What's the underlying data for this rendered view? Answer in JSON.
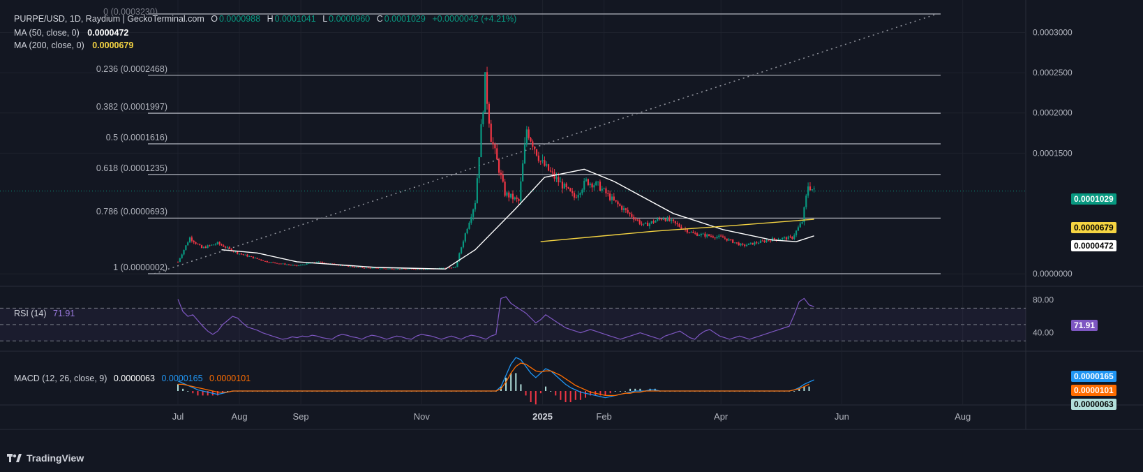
{
  "header": {
    "symbol": "PURPE/USD, 1D, Raydium | GeckoTerminal.com",
    "o_label": "O",
    "o_value": "0.0000988",
    "h_label": "H",
    "h_value": "0.0001041",
    "l_label": "L",
    "l_value": "0.0000960",
    "c_label": "C",
    "c_value": "0.0001029",
    "change": "+0.0000042 (+4.21%)"
  },
  "ma50": {
    "label": "MA (50, close, 0)",
    "value": "0.0000472",
    "color": "#ffffff"
  },
  "ma200": {
    "label": "MA (200, close, 0)",
    "value": "0.0000679",
    "color": "#f5d442"
  },
  "fib_levels": [
    {
      "label": "0 (0.0003230)",
      "price": 0.000323
    },
    {
      "label": "0.236 (0.0002468)",
      "price": 0.0002468
    },
    {
      "label": "0.382 (0.0001997)",
      "price": 0.0001997
    },
    {
      "label": "0.5 (0.0001616)",
      "price": 0.0001616
    },
    {
      "label": "0.618 (0.0001235)",
      "price": 0.0001235
    },
    {
      "label": "0.786 (0.0000693)",
      "price": 6.93e-05
    },
    {
      "label": "1 (0.0000002)",
      "price": 2e-07
    }
  ],
  "price_axis": {
    "ticks": [
      {
        "label": "0.0003000",
        "value": 0.0003
      },
      {
        "label": "0.0002500",
        "value": 0.00025
      },
      {
        "label": "0.0002000",
        "value": 0.0002
      },
      {
        "label": "0.0001500",
        "value": 0.00015
      },
      {
        "label": "0.0000000",
        "value": 0.0
      }
    ],
    "current_price": {
      "label": "0.0001029",
      "value": 0.0001029,
      "color": "#089981"
    },
    "ma200_tag": {
      "label": "0.0000679",
      "value": 6.79e-05,
      "color": "#f5d442"
    },
    "ma50_tag": {
      "label": "0.0000472",
      "value": 4.72e-05,
      "color": "#ffffff"
    }
  },
  "rsi": {
    "label": "RSI (14)",
    "value": "71.91",
    "color": "#7e57c2",
    "ticks": [
      {
        "label": "80.00",
        "value": 80
      },
      {
        "label": "40.00",
        "value": 40
      }
    ],
    "upper": 70,
    "lower": 30,
    "series": [
      81,
      66,
      60,
      62,
      55,
      48,
      42,
      38,
      42,
      50,
      55,
      60,
      58,
      52,
      47,
      45,
      43,
      40,
      38,
      36,
      34,
      32,
      33,
      35,
      34,
      36,
      35,
      37,
      36,
      34,
      33,
      32,
      36,
      38,
      37,
      35,
      34,
      32,
      35,
      37,
      36,
      34,
      32,
      34,
      36,
      35,
      33,
      32,
      36,
      38,
      37,
      36,
      34,
      32,
      34,
      36,
      34,
      32,
      35,
      37,
      36,
      34,
      32,
      36,
      38,
      82,
      84,
      76,
      72,
      68,
      64,
      58,
      52,
      56,
      62,
      58,
      54,
      50,
      46,
      44,
      42,
      40,
      42,
      44,
      42,
      40,
      38,
      36,
      34,
      32,
      34,
      36,
      38,
      40,
      38,
      36,
      34,
      32,
      36,
      38,
      40,
      42,
      38,
      34,
      32,
      38,
      42,
      44,
      40,
      36,
      34,
      32,
      34,
      36,
      34,
      32,
      34,
      36,
      38,
      40,
      42,
      44,
      46,
      48,
      62,
      78,
      82,
      74,
      71.91
    ]
  },
  "macd": {
    "label": "MACD (12, 26, close, 9)",
    "hist_value": "0.0000063",
    "macd_value": "0.0000165",
    "signal_value": "0.0000101",
    "macd_color": "#2196f3",
    "signal_color": "#ff6d00",
    "hist_color": "#b2dfdb",
    "macd_series": [
      9,
      7,
      5,
      3,
      1,
      0,
      -1,
      -2,
      -3,
      -2,
      -1,
      0,
      0,
      0,
      0,
      0,
      0,
      0,
      0,
      0,
      0,
      0,
      0,
      0,
      0,
      0,
      0,
      0,
      0,
      0,
      0,
      0,
      0,
      0,
      0,
      0,
      0,
      0,
      0,
      0,
      0,
      0,
      0,
      0,
      0,
      0,
      0,
      0,
      0,
      0,
      0,
      0,
      0,
      0,
      0,
      0,
      0,
      0,
      0,
      0,
      0,
      0,
      0,
      0,
      0,
      4,
      14,
      24,
      30,
      28,
      22,
      16,
      12,
      16,
      20,
      18,
      14,
      10,
      6,
      3,
      1,
      -1,
      -2,
      -3,
      -4,
      -5,
      -6,
      -5,
      -4,
      -3,
      -2,
      -1,
      0,
      0,
      0,
      1,
      1,
      0,
      0,
      0,
      0,
      0,
      0,
      0,
      0,
      0,
      0,
      0,
      0,
      0,
      0,
      0,
      0,
      0,
      0,
      0,
      0,
      0,
      0,
      0,
      0,
      0,
      0,
      0,
      1,
      3,
      6,
      8,
      10
    ],
    "signal_series": [
      6,
      6,
      5,
      4,
      3,
      2,
      1,
      0,
      -1,
      -1,
      -1,
      0,
      0,
      0,
      0,
      0,
      0,
      0,
      0,
      0,
      0,
      0,
      0,
      0,
      0,
      0,
      0,
      0,
      0,
      0,
      0,
      0,
      0,
      0,
      0,
      0,
      0,
      0,
      0,
      0,
      0,
      0,
      0,
      0,
      0,
      0,
      0,
      0,
      0,
      0,
      0,
      0,
      0,
      0,
      0,
      0,
      0,
      0,
      0,
      0,
      0,
      0,
      0,
      0,
      0,
      2,
      8,
      16,
      22,
      25,
      24,
      21,
      18,
      17,
      18,
      18,
      16,
      14,
      11,
      8,
      5,
      3,
      1,
      -1,
      -2,
      -3,
      -4,
      -4,
      -4,
      -3,
      -2,
      -2,
      -1,
      -1,
      0,
      0,
      0,
      0,
      0,
      0,
      0,
      0,
      0,
      0,
      0,
      0,
      0,
      0,
      0,
      0,
      0,
      0,
      0,
      0,
      0,
      0,
      0,
      0,
      0,
      0,
      0,
      0,
      0,
      0,
      1,
      2,
      4,
      6
    ]
  },
  "time_axis": {
    "ticks": [
      {
        "label": "Jul",
        "day": 0,
        "bold": false
      },
      {
        "label": "Aug",
        "day": 31,
        "bold": false
      },
      {
        "label": "Sep",
        "day": 62,
        "bold": false
      },
      {
        "label": "Nov",
        "day": 123,
        "bold": false
      },
      {
        "label": "2025",
        "day": 184,
        "bold": true
      },
      {
        "label": "Feb",
        "day": 215,
        "bold": false
      },
      {
        "label": "Apr",
        "day": 274,
        "bold": false
      },
      {
        "label": "Jun",
        "day": 335,
        "bold": false
      },
      {
        "label": "Aug",
        "day": 396,
        "bold": false
      }
    ]
  },
  "chart_data": {
    "type": "candlestick",
    "price_points": [
      {
        "day": -12,
        "price": 2e-07
      },
      {
        "day": 0,
        "price": 1.5e-05
      },
      {
        "day": 6,
        "price": 4.5e-05
      },
      {
        "day": 12,
        "price": 3.2e-05
      },
      {
        "day": 20,
        "price": 3.8e-05
      },
      {
        "day": 30,
        "price": 2.6e-05
      },
      {
        "day": 45,
        "price": 1.5e-05
      },
      {
        "day": 60,
        "price": 1e-05
      },
      {
        "day": 70,
        "price": 1.5e-05
      },
      {
        "day": 90,
        "price": 8e-06
      },
      {
        "day": 110,
        "price": 6e-06
      },
      {
        "day": 125,
        "price": 6e-06
      },
      {
        "day": 140,
        "price": 8e-06
      },
      {
        "day": 145,
        "price": 5e-05
      },
      {
        "day": 150,
        "price": 9e-05
      },
      {
        "day": 155,
        "price": 0.00024
      },
      {
        "day": 158,
        "price": 0.00017
      },
      {
        "day": 165,
        "price": 0.0001
      },
      {
        "day": 172,
        "price": 9e-05
      },
      {
        "day": 176,
        "price": 0.00018
      },
      {
        "day": 183,
        "price": 0.00014
      },
      {
        "day": 190,
        "price": 0.00012
      },
      {
        "day": 200,
        "price": 9.5e-05
      },
      {
        "day": 206,
        "price": 0.000115
      },
      {
        "day": 212,
        "price": 0.00011
      },
      {
        "day": 220,
        "price": 9e-05
      },
      {
        "day": 235,
        "price": 6e-05
      },
      {
        "day": 245,
        "price": 7e-05
      },
      {
        "day": 260,
        "price": 5e-05
      },
      {
        "day": 275,
        "price": 4.5e-05
      },
      {
        "day": 285,
        "price": 3.5e-05
      },
      {
        "day": 300,
        "price": 4.3e-05
      },
      {
        "day": 310,
        "price": 4.5e-05
      },
      {
        "day": 315,
        "price": 6.5e-05
      },
      {
        "day": 318,
        "price": 0.00011
      },
      {
        "day": 321,
        "price": 0.0001029
      }
    ],
    "ma50_points": [
      {
        "day": 22,
        "price": 3e-05
      },
      {
        "day": 40,
        "price": 2.6e-05
      },
      {
        "day": 60,
        "price": 1.5e-05
      },
      {
        "day": 100,
        "price": 8e-06
      },
      {
        "day": 135,
        "price": 6e-06
      },
      {
        "day": 150,
        "price": 3e-05
      },
      {
        "day": 170,
        "price": 8e-05
      },
      {
        "day": 185,
        "price": 0.00012
      },
      {
        "day": 205,
        "price": 0.00013
      },
      {
        "day": 220,
        "price": 0.000115
      },
      {
        "day": 250,
        "price": 7.5e-05
      },
      {
        "day": 275,
        "price": 5.5e-05
      },
      {
        "day": 300,
        "price": 4.2e-05
      },
      {
        "day": 312,
        "price": 4e-05
      },
      {
        "day": 321,
        "price": 4.72e-05
      }
    ],
    "ma200_points": [
      {
        "day": 183,
        "price": 4e-05
      },
      {
        "day": 240,
        "price": 5.3e-05
      },
      {
        "day": 280,
        "price": 6e-05
      },
      {
        "day": 321,
        "price": 6.79e-05
      }
    ],
    "trendline": [
      {
        "day": -12,
        "price": 2e-07
      },
      {
        "day": 383,
        "price": 0.000323
      }
    ]
  },
  "branding": {
    "name": "TradingView"
  }
}
